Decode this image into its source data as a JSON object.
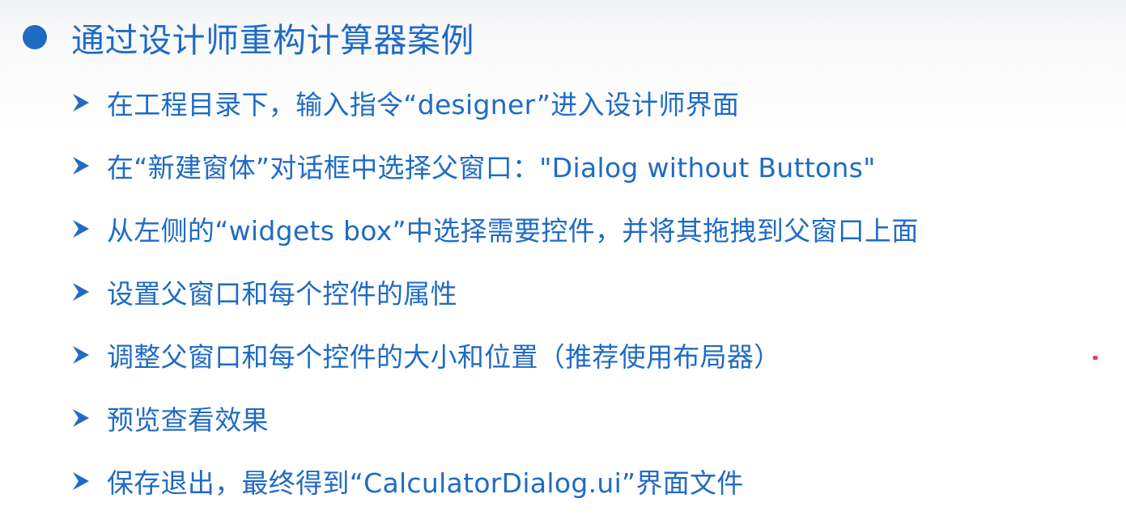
{
  "slide": {
    "title": "通过设计师重构计算器案例",
    "items": [
      {
        "text": "在工程目录下，输入指令“designer”进入设计师界面"
      },
      {
        "text": "在“新建窗体”对话框中选择父窗口：\"Dialog without Buttons\""
      },
      {
        "text": "从左侧的“widgets box”中选择需要控件，并将其拖拽到父窗口上面"
      },
      {
        "text": "设置父窗口和每个控件的属性"
      },
      {
        "text": "调整父窗口和每个控件的大小和位置（推荐使用布局器）"
      },
      {
        "text": "预览查看效果"
      },
      {
        "text": "保存退出，最终得到“CalculatorDialog.ui”界面文件"
      }
    ]
  },
  "colors": {
    "text": "#1f6bc4",
    "bullet": "#1f6bc4",
    "background": "#ffffff"
  },
  "icons": {
    "title_bullet": "filled-circle-icon",
    "item_bullet": "arrow-bullet-icon"
  }
}
